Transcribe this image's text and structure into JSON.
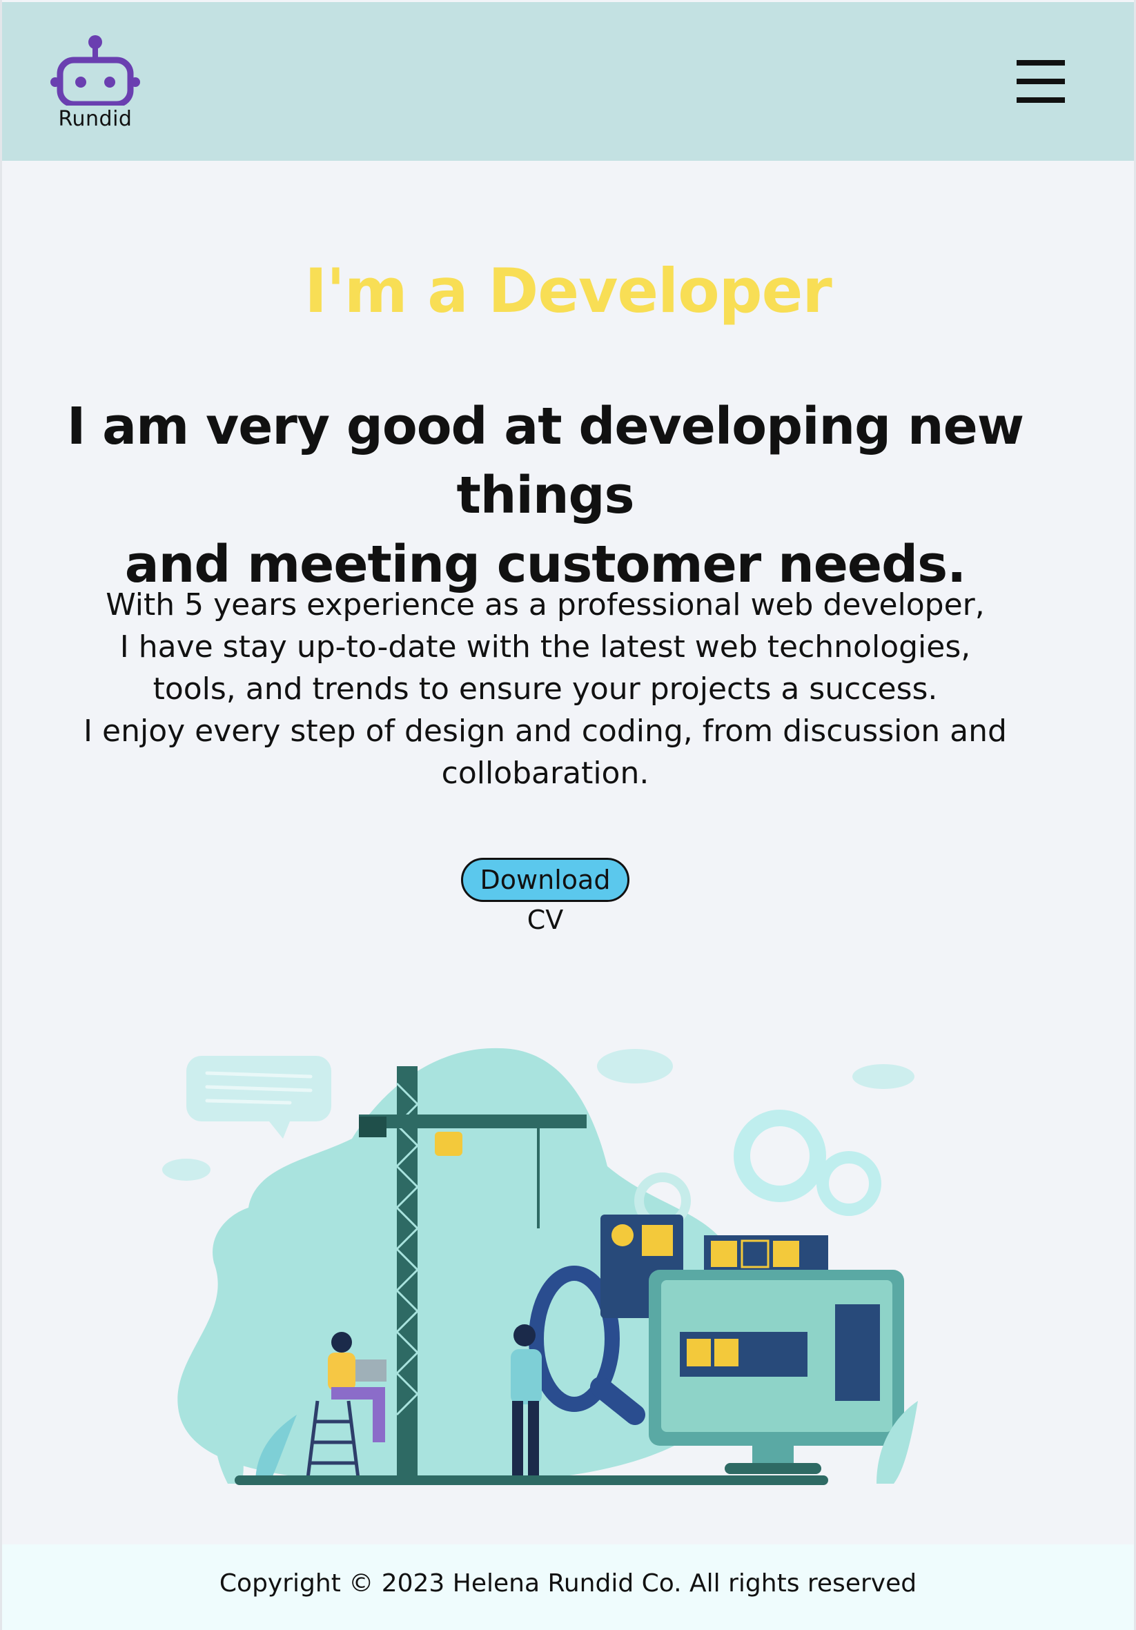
{
  "brand": {
    "name": "Rundid",
    "logo_icon": "robot-icon",
    "logo_color": "#6a3fb0"
  },
  "nav": {
    "menu_icon": "hamburger-menu-icon"
  },
  "hero": {
    "eyebrow": "I'm a Developer",
    "headline_line1": "I am very good at developing new things",
    "headline_line2": "and meeting customer needs.",
    "description": [
      "With 5 years experience as a professional web developer,",
      "I have stay up-to-date with the latest web technologies,",
      "tools, and trends to ensure your projects a success.",
      "I enjoy every step of design and coding, from discussion and",
      "collobaration."
    ],
    "cta_label": "Download CV",
    "accent_color": "#f8de55",
    "button_color": "#5bc8ed"
  },
  "footer": {
    "copyright": "Copyright © 2023 Helena Rundid Co. All rights reserved"
  }
}
